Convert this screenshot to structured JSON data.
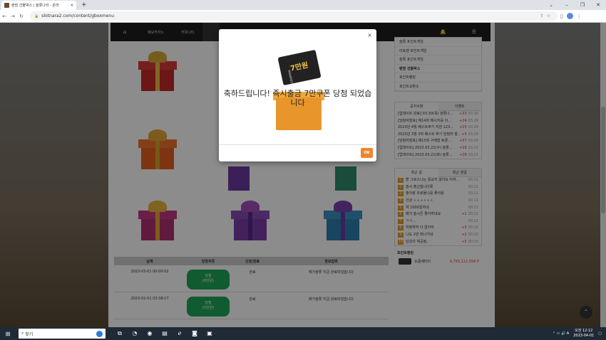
{
  "browser": {
    "tab_title": "랜덤 선물박스 | 슬롯나라 - 온라",
    "url": "slotnara2.com/content/gboxmenu"
  },
  "site_nav": {
    "items": [
      "메모카지노",
      "커뮤니티"
    ]
  },
  "modal": {
    "close_symbol": "×",
    "coupon_text": "7만원",
    "coupon_side": "COUPON",
    "message": "축하드립니다! 즉시출금 7만쿠폰 당첨 되었습니다",
    "ok_label": "OK"
  },
  "table": {
    "headers": [
      "날짜",
      "당첨쿠폰",
      "신청/완료",
      "정보입력"
    ],
    "rows": [
      {
        "date": "2023-03-01 00:00:02",
        "coupon_line1": "당첨",
        "coupon_line2": "(8만원)",
        "status": "완료",
        "info": "메가슬롯 지급 완료되었습니다"
      },
      {
        "date": "2023-02-01 03:38:17",
        "coupon_line1": "당첨",
        "coupon_line2": "(5만원)",
        "status": "완료",
        "info": "메가슬롯 지급 완료되었습니다"
      }
    ]
  },
  "sidebar": {
    "menu": [
      "슬롯 포인트게임",
      "이토랜 포인트게임",
      "슬롯 포인트게임",
      "랜덤 선물박스",
      "포인트랭킹",
      "포인트교환소"
    ],
    "notice_tabs": [
      "공지사항",
      "이벤트"
    ],
    "notices": [
      {
        "text": "[업데이트 완료] 03.30(목) 슬롯나...",
        "count": "+33",
        "date": "03.30"
      },
      {
        "text": "[당첨자발표] 제14회 메시지를 이...",
        "count": "+24",
        "date": "03.29"
      },
      {
        "text": "2023년 4월 베스트후기 지원 123...",
        "count": "+15",
        "date": "03.29"
      },
      {
        "text": "2023년 3월 3차 베스트 후기 당첨자 발...",
        "count": "+5",
        "date": "03.29"
      },
      {
        "text": "[당첨자발표] 제13회 구매형 토론...",
        "count": "+57",
        "date": "03.26"
      },
      {
        "text": "[업데이트] 2023.03.22(수) 슬롯...",
        "count": "+16",
        "date": "03.22"
      },
      {
        "text": "[업데이트] 2023.03.21(화) 슬롯...",
        "count": "+26",
        "date": "03.21"
      }
    ],
    "recent_tabs": [
      "최근 글",
      "최근 댓글"
    ],
    "recent": [
      {
        "n": "1",
        "text": "할 그로스나는 중요지 않아요 아자...",
        "count": "",
        "date": "00:11"
      },
      {
        "n": "2",
        "text": "슬시 출근합니다롯",
        "count": "",
        "date": "00:11"
      },
      {
        "n": "3",
        "text": "출이랑 유로들나를 좋아용",
        "count": "",
        "date": "00:11"
      },
      {
        "n": "4",
        "text": "신상 ㅅㅅㅅㅅㅅㅅ",
        "count": "",
        "date": "00:11"
      },
      {
        "n": "5",
        "text": "약 1000일자네",
        "count": "",
        "date": "00:11"
      },
      {
        "n": "6",
        "text": "메가 슬시즌 좋아하네요",
        "count": "+1",
        "date": "00:11"
      },
      {
        "n": "7",
        "text": "ㅋㅋ...",
        "count": "",
        "date": "00:11"
      },
      {
        "n": "8",
        "text": "자정하여 다 알아야",
        "count": "+3",
        "date": "00:10"
      },
      {
        "n": "9",
        "text": "나도 2만 떠나거네",
        "count": "+2",
        "date": "00:10"
      },
      {
        "n": "10",
        "text": "감성의 체공됨,",
        "count": "+5",
        "date": "00:10"
      }
    ],
    "rank_title": "포인트랭킹",
    "rank_user": "요즘베터터",
    "rank_points": "6,755,111,556 P"
  },
  "taskbar": {
    "search_placeholder": "찾기",
    "time": "오전 12:12",
    "date": "2023-04-01"
  },
  "colors": {
    "accent": "#f0852d",
    "won": "#1fa65a",
    "nav": "#1e1e1e"
  }
}
